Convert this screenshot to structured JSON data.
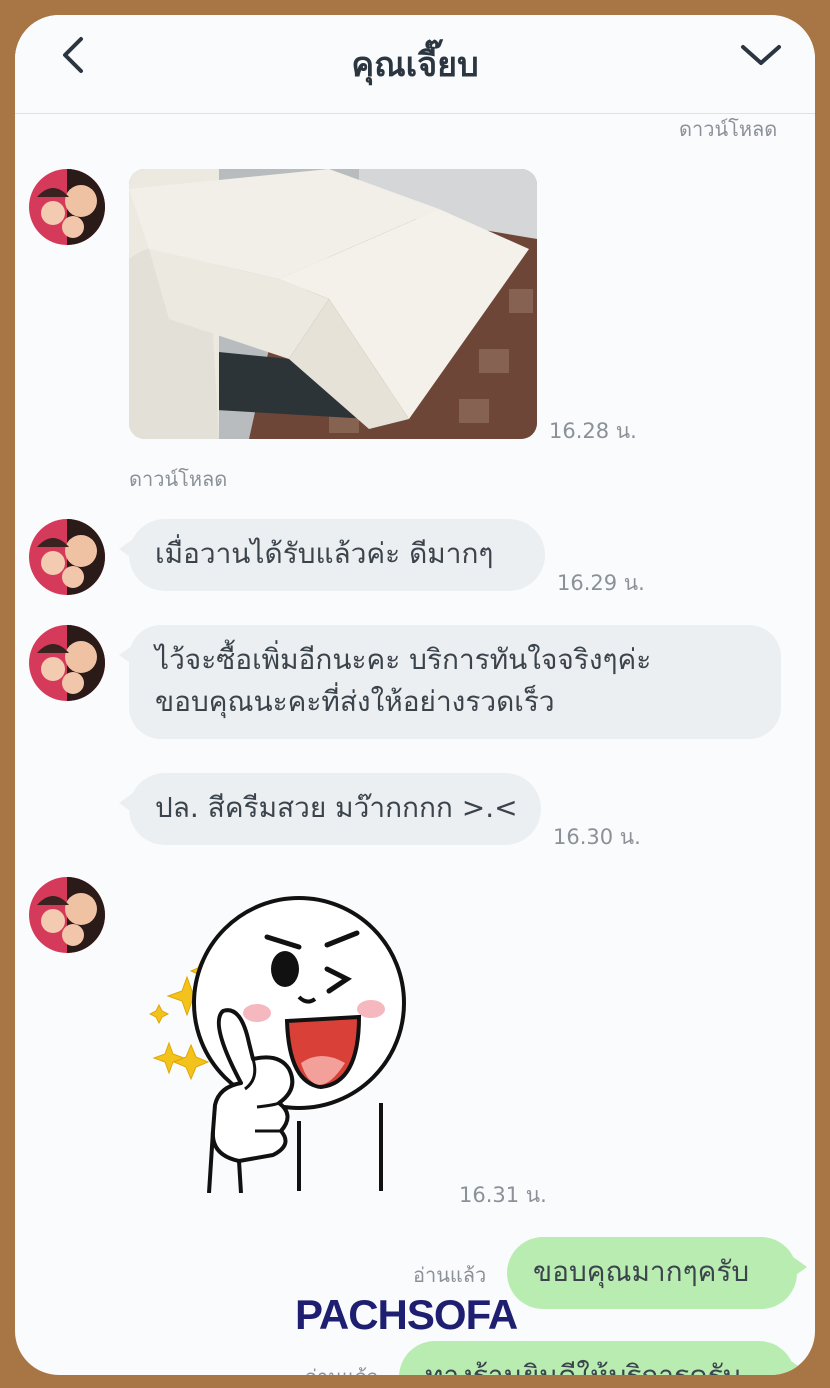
{
  "header": {
    "title": "คุณเจี๊ยบ"
  },
  "messages": {
    "download_label_1": "ดาวน์โหลด",
    "photo_time": "16.28 น.",
    "download_label_2": "ดาวน์โหลด",
    "msg1": {
      "text": "เมื่อวานได้รับแล้วค่ะ ดีมากๆ",
      "time": "16.29 น."
    },
    "msg2": {
      "line1": "ไว้จะซื้อเพิ่มอีกนะคะ บริการทันใจจริงๆค่ะ",
      "line2": "ขอบคุณนะคะที่ส่งให้อย่างรวดเร็ว"
    },
    "msg3": {
      "text": "ปล. สีครีมสวย มว๊ากกกก >.<",
      "time": "16.30 น."
    },
    "sticker_time": "16.31 น.",
    "read_label_1": "อ่านแล้ว",
    "reply1": {
      "text": "ขอบคุณมากๆครับ"
    },
    "read_label_2": "อ่านแล้ว",
    "reply2": {
      "text": "ทางร้านยินดีให้บริการครับ"
    }
  },
  "watermark": "PACHSOFA",
  "colors": {
    "frame": "#a87545",
    "incoming_bubble": "#eceff1",
    "outgoing_bubble": "#b9ecb0",
    "watermark": "#1e1f70"
  },
  "icons": [
    "back-arrow-icon",
    "chevron-down-icon"
  ]
}
